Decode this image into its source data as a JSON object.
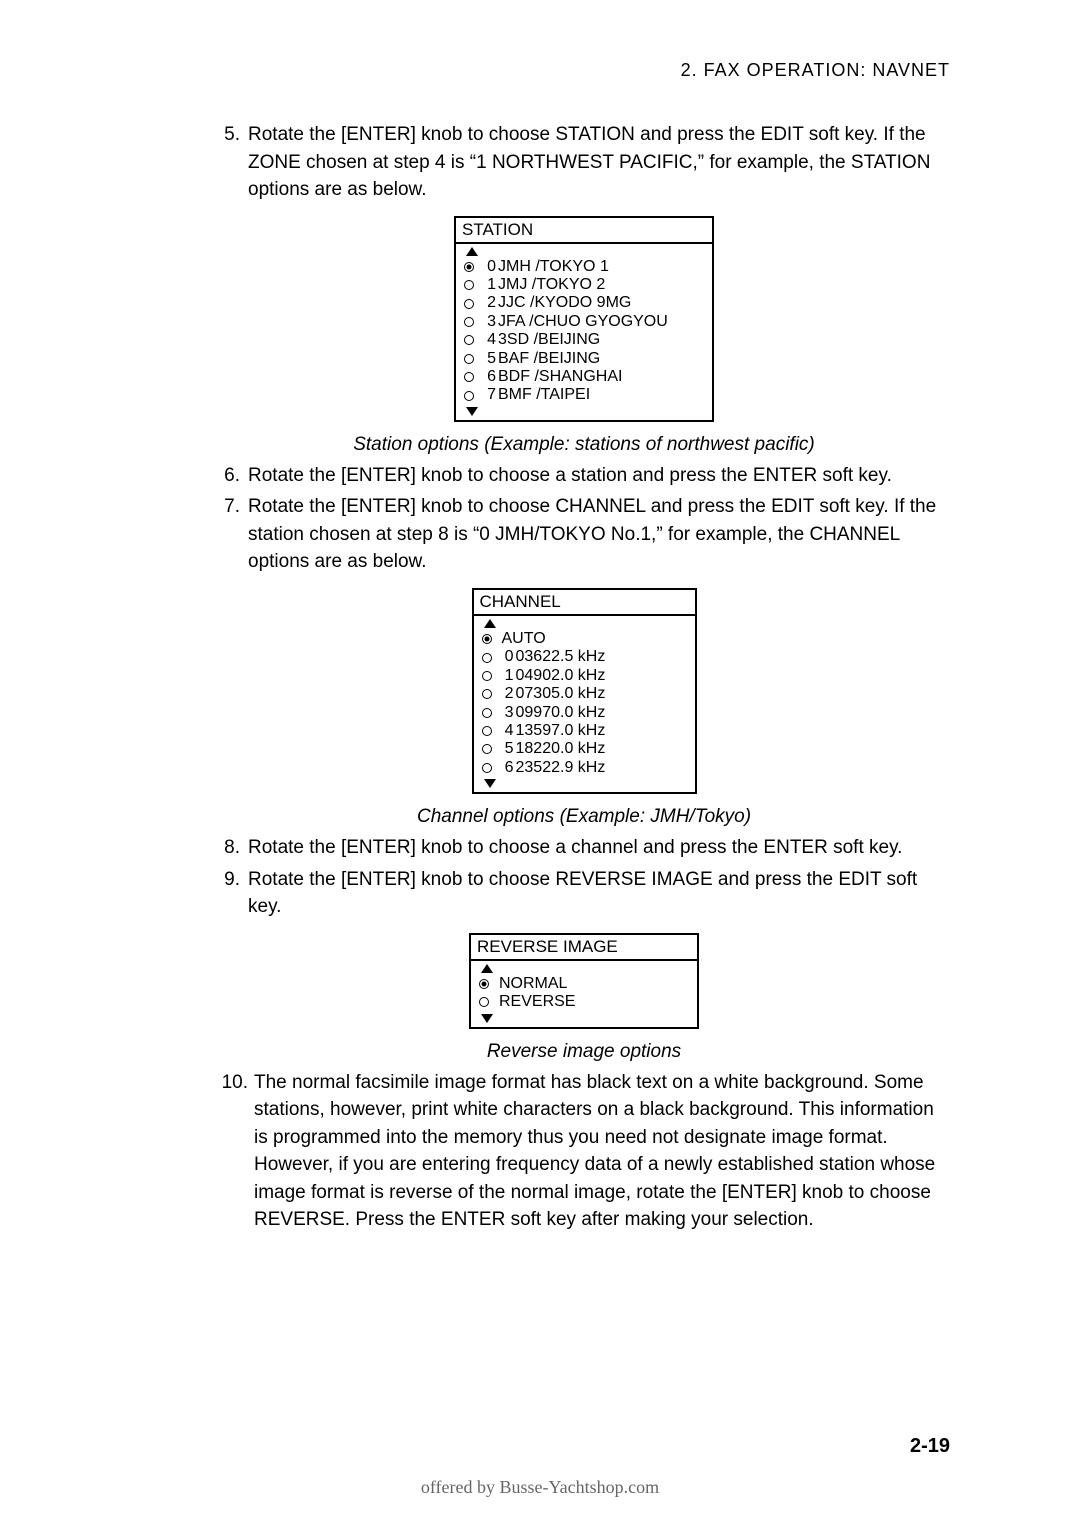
{
  "header": "2. FAX OPERATION: NAVNET",
  "items": {
    "i5": {
      "num": "5.",
      "text": "Rotate the [ENTER] knob to choose STATION and press the EDIT soft key. If the ZONE chosen at step 4 is “1 NORTHWEST PACIFIC,” for example, the STATION options are as below."
    },
    "i6": {
      "num": "6.",
      "text": "Rotate the [ENTER] knob to choose a station and press the ENTER soft key."
    },
    "i7": {
      "num": "7.",
      "text": "Rotate the [ENTER] knob to choose CHANNEL and press the EDIT soft key. If the station chosen at step 8 is “0 JMH/TOKYO No.1,” for example, the CHANNEL options are as below."
    },
    "i8": {
      "num": "8.",
      "text": "Rotate the [ENTER] knob to choose a channel and press the ENTER soft key."
    },
    "i9": {
      "num": "9.",
      "text": "Rotate the [ENTER] knob to choose REVERSE IMAGE and press the EDIT soft key."
    },
    "i10": {
      "num": "10.",
      "text": "The normal facsimile image format has black text on a white background. Some stations, however, print white characters on a black background. This information is programmed into the memory thus you need not designate image format. However, if you are entering frequency data of a newly established station whose image format is reverse of the normal image, rotate the [ENTER] knob to choose REVERSE. Press the ENTER soft key after making your selection."
    }
  },
  "station": {
    "title": "STATION",
    "items": [
      {
        "n": "0",
        "label": "JMH /TOKYO 1"
      },
      {
        "n": "1",
        "label": "JMJ /TOKYO 2"
      },
      {
        "n": "2",
        "label": "JJC /KYODO 9MG"
      },
      {
        "n": "3",
        "label": "JFA /CHUO GYOGYOU"
      },
      {
        "n": "4",
        "label": "3SD /BEIJING"
      },
      {
        "n": "5",
        "label": "BAF /BEIJING"
      },
      {
        "n": "6",
        "label": "BDF /SHANGHAI"
      },
      {
        "n": "7",
        "label": "BMF /TAIPEI"
      }
    ],
    "caption": "Station options (Example: stations of northwest pacific)"
  },
  "channel": {
    "title": "CHANNEL",
    "items": [
      {
        "n": "",
        "label": "AUTO"
      },
      {
        "n": "0",
        "label": "03622.5 kHz"
      },
      {
        "n": "1",
        "label": "04902.0 kHz"
      },
      {
        "n": "2",
        "label": "07305.0 kHz"
      },
      {
        "n": "3",
        "label": "09970.0 kHz"
      },
      {
        "n": "4",
        "label": "13597.0 kHz"
      },
      {
        "n": "5",
        "label": "18220.0 kHz"
      },
      {
        "n": "6",
        "label": "23522.9 kHz"
      }
    ],
    "caption": "Channel options (Example: JMH/Tokyo)"
  },
  "reverse": {
    "title": "REVERSE IMAGE",
    "items": [
      {
        "label": "NORMAL"
      },
      {
        "label": "REVERSE"
      }
    ],
    "caption": "Reverse image options"
  },
  "pageNum": "2-19",
  "footer": "offered by Busse-Yachtshop.com"
}
